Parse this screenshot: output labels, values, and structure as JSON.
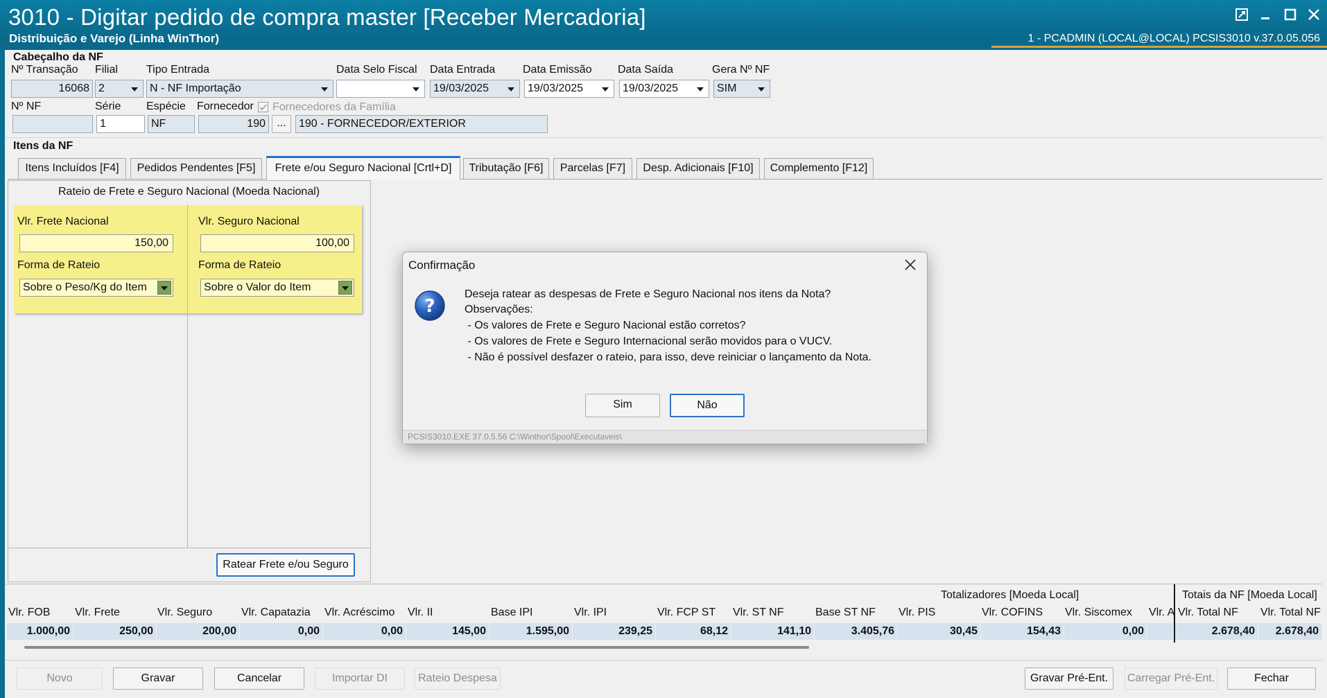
{
  "window": {
    "title": "3010 - Digitar pedido de compra master [Receber Mercadoria]",
    "subtitle": "Distribuição e Varejo (Linha WinThor)",
    "status": "1 - PCADMIN (LOCAL@LOCAL)   PCSIS3010  v.37.0.05.056"
  },
  "header": {
    "section_title": "Cabeçalho da NF",
    "n_transacao_label": "Nº Transação",
    "n_transacao": "16068",
    "filial_label": "Filial",
    "filial": "2",
    "tipo_entrada_label": "Tipo Entrada",
    "tipo_entrada": "N - NF Importação",
    "data_selo_label": "Data Selo Fiscal",
    "data_selo": "",
    "data_entrada_label": "Data Entrada",
    "data_entrada": "19/03/2025",
    "data_emissao_label": "Data Emissão",
    "data_emissao": "19/03/2025",
    "data_saida_label": "Data Saída",
    "data_saida": "19/03/2025",
    "gera_nf_label": "Gera Nº NF",
    "gera_nf": "SIM",
    "n_nf_label": "Nº NF",
    "n_nf": "",
    "serie_label": "Série",
    "serie": "1",
    "especie_label": "Espécie",
    "especie": "NF",
    "fornecedor_label": "Fornecedor",
    "fornecedor_code": "190",
    "fornecedores_familia_label": "Fornecedores da Família",
    "fornecedor_name": "190 - FORNECEDOR/EXTERIOR",
    "ellipsis": "..."
  },
  "items": {
    "section_title": "Itens da NF",
    "tabs": [
      "Itens Incluídos [F4]",
      "Pedidos Pendentes [F5]",
      "Frete e/ou Seguro Nacional [Crtl+D]",
      "Tributação [F6]",
      "Parcelas [F7]",
      "Desp. Adicionais [F10]",
      "Complemento [F12]"
    ]
  },
  "rateio": {
    "title": "Rateio de Frete e Seguro Nacional (Moeda Nacional)",
    "frete_label": "Vlr. Frete Nacional",
    "frete_value": "150,00",
    "seguro_label": "Vlr. Seguro Nacional",
    "seguro_value": "100,00",
    "forma_label": "Forma de Rateio",
    "forma_frete": "Sobre o Peso/Kg do Item",
    "forma_seguro": "Sobre o Valor do Item",
    "button": "Ratear Frete e/ou Seguro"
  },
  "totals": {
    "group_label": "Totalizadores [Moeda Local]",
    "nf_group_label": "Totais da NF [Moeda Local]",
    "columns": [
      "Vlr. FOB",
      "Vlr. Frete",
      "Vlr. Seguro",
      "Vlr. Capatazia",
      "Vlr. Acréscimo",
      "Vlr. II",
      "Base IPI",
      "Vlr. IPI",
      "Vlr. FCP ST",
      "Vlr. ST NF",
      "Base ST NF",
      "Vlr. PIS",
      "Vlr. COFINS",
      "Vlr. Siscomex",
      "Vlr. A"
    ],
    "values": [
      "1.000,00",
      "250,00",
      "200,00",
      "0,00",
      "0,00",
      "145,00",
      "1.595,00",
      "239,25",
      "68,12",
      "141,10",
      "3.405,76",
      "30,45",
      "154,43",
      "0,00",
      ""
    ],
    "nf_columns": [
      "Vlr. Total NF",
      "Vlr. Total NF"
    ],
    "nf_values": [
      "2.678,40",
      "2.678,40"
    ]
  },
  "footer_buttons": {
    "novo": "Novo",
    "gravar": "Gravar",
    "cancelar": "Cancelar",
    "importar_di": "Importar DI",
    "rateio_despesa": "Rateio Despesa",
    "gravar_pre": "Gravar Pré-Ent.",
    "carregar_pre": "Carregar Pré-Ent.",
    "fechar": "Fechar"
  },
  "dialog": {
    "title": "Confirmação",
    "lines": [
      "Deseja ratear as despesas de Frete e Seguro Nacional nos itens da Nota?",
      "Observações:",
      " - Os valores de Frete e Seguro Nacional estão corretos?",
      " - Os valores de Frete e Seguro Internacional serão movidos para o VUCV.",
      " - Não é possível desfazer o rateio, para isso, deve reiniciar o lançamento da Nota."
    ],
    "yes": "Sim",
    "no": "Não",
    "footer": "PCSIS3010.EXE 37.0.5.56 C:\\Winthor\\Spool\\Executaveis\\"
  },
  "colors": {
    "titlebar": "#0a6f91",
    "highlight": "#f7f08a",
    "accent": "#2a75c4"
  }
}
